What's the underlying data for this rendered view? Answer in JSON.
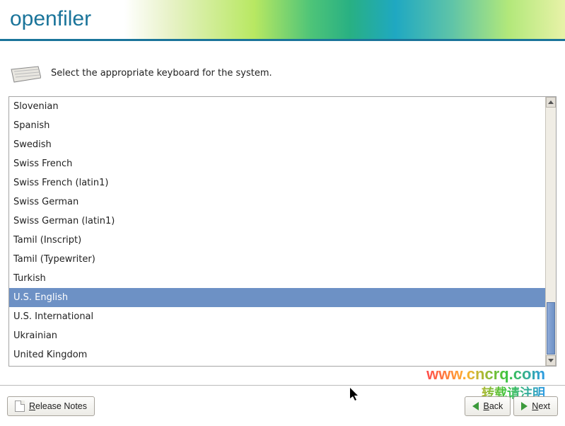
{
  "header": {
    "logo": "openfiler"
  },
  "prompt": "Select the appropriate keyboard for the system.",
  "keyboard_list": {
    "selected_index": 10,
    "items": [
      "Slovenian",
      "Spanish",
      "Swedish",
      "Swiss French",
      "Swiss French (latin1)",
      "Swiss German",
      "Swiss German (latin1)",
      "Tamil (Inscript)",
      "Tamil (Typewriter)",
      "Turkish",
      "U.S. English",
      "U.S. International",
      "Ukrainian",
      "United Kingdom"
    ]
  },
  "buttons": {
    "release_notes": "Release Notes",
    "back": "Back",
    "next": "Next"
  },
  "watermark": {
    "l1": "www.cncrq.com",
    "l2": "转载请注明"
  }
}
